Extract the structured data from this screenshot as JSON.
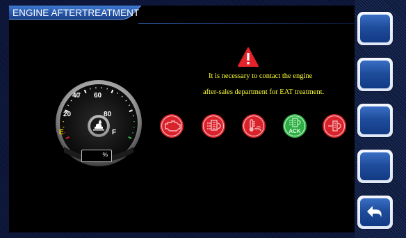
{
  "title": "ENGINE AFTERTREATMENT",
  "message": {
    "line1": "It is necessary to contact the engine",
    "line2": "after-sales department for EAT treatment."
  },
  "gauge": {
    "labels": [
      "20",
      "40",
      "60",
      "80"
    ],
    "empty_label": "E",
    "full_label": "F",
    "percent_unit": "%",
    "icon": "def-fluid-icon"
  },
  "status_icons": [
    {
      "name": "engine-icon",
      "state": "warning"
    },
    {
      "name": "exhaust-filter-icon",
      "state": "warning"
    },
    {
      "name": "exhaust-temperature-icon",
      "state": "warning"
    },
    {
      "name": "regeneration-ack-icon",
      "state": "ok",
      "label": "ACK"
    },
    {
      "name": "dpf-icon",
      "state": "warning"
    }
  ],
  "side_buttons": [
    {
      "name": "softkey-1"
    },
    {
      "name": "softkey-2"
    },
    {
      "name": "softkey-3"
    },
    {
      "name": "softkey-4"
    },
    {
      "name": "back-button",
      "icon": "return-arrow-icon"
    }
  ],
  "colors": {
    "warning": "#e0222b",
    "ok": "#35b84a",
    "text_message": "#ffff33",
    "accent": "#1f4d9c"
  }
}
